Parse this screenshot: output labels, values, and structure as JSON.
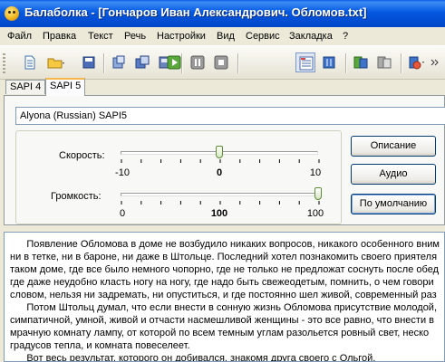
{
  "window": {
    "title": "Балаболка - [Гончаров Иван Александрович. Обломов.txt]",
    "title_color": "#0458e0"
  },
  "menu": {
    "items": [
      "Файл",
      "Правка",
      "Текст",
      "Речь",
      "Настройки",
      "Вид",
      "Сервис",
      "Закладка",
      "?"
    ]
  },
  "toolbar": {
    "buttons": [
      {
        "name": "new-document-icon"
      },
      {
        "name": "open-folder-icon"
      },
      {
        "name": "save-icon"
      },
      {
        "name": "open-audio-icon"
      },
      {
        "name": "save-audio-icon"
      },
      {
        "name": "batch-convert-icon"
      },
      {
        "name": "play-icon"
      },
      {
        "name": "pause-icon"
      },
      {
        "name": "stop-icon"
      },
      {
        "name": "settings-list-icon"
      },
      {
        "name": "dictionary-icon"
      },
      {
        "name": "clipboard-read-icon"
      },
      {
        "name": "clipboard-pause-icon"
      },
      {
        "name": "voice-settings-icon"
      },
      {
        "name": "more-icon"
      }
    ]
  },
  "tabs": [
    "SAPI 4",
    "SAPI 5"
  ],
  "voice": {
    "selected": "Alyona (Russian) SAPI5"
  },
  "rate": {
    "label": "Скорость:",
    "min_label": "-10",
    "max_label": "10",
    "value_label": "0",
    "min": -10,
    "max": 10,
    "value": 0
  },
  "volume": {
    "label": "Громкость:",
    "min_label": "0",
    "max_label": "100",
    "value_label": "100",
    "min": 0,
    "max": 100,
    "value": 100
  },
  "buttons": {
    "description": "Описание",
    "audio": "Аудио",
    "default": "По умолчанию"
  },
  "text": {
    "lines": [
      "      Появление Обломова в доме не возбудило никаких вопросов, никакого особенного вним",
      "ни в тетке, ни в бароне, ни даже в Штольце. Последний хотел познакомить своего приятеля",
      "таком доме, где все было немного чопорно, где не только не предложат соснуть после обед",
      "где даже неудобно класть ногу на ногу, где надо быть свежеодетым, помнить, о чем говори",
      "словом, нельзя ни задремать, ни опуститься, и где постоянно шел живой, современный раз",
      "      Потом Штольц думал, что если внести в сонную жизнь Обломова присутствие молодой,",
      "симпатичной, умной, живой и отчасти насмешливой женщины - это все равно, что внести в",
      "мрачную комнату лампу, от которой по всем темным углам разольется ровный свет, неско",
      "градусов тепла, и комната повеселеет.",
      "      Вот весь результат, которого он добивался, знакомя друга своего с Ольгой."
    ]
  }
}
